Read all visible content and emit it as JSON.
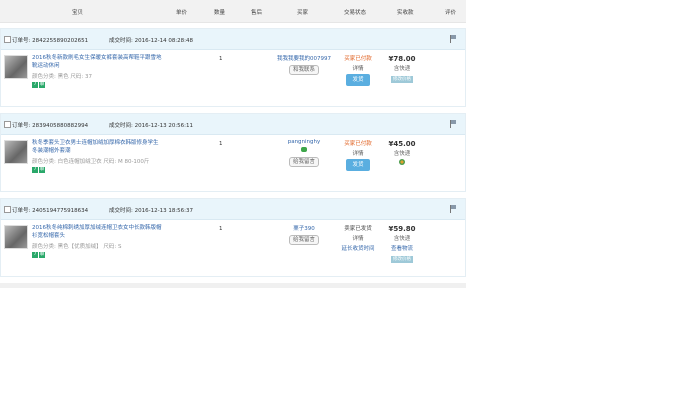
{
  "header": {
    "product": "宝贝",
    "unit_price": "单价",
    "quantity": "数量",
    "after_sale": "售后",
    "buyer": "买家",
    "trade_status": "交易状态",
    "paid": "实收款",
    "rating": "评价"
  },
  "orders": [
    {
      "order_no": "订单号: 2842255890202651",
      "deal_time": "成交时间: 2016-12-14 08:28:48",
      "title": "2016秋冬新款刷毛女生保暖女裤套装高帮鞋平跟雪地靴运动休闲",
      "sku": "颜色分类: 黑色  尺码: 37",
      "qty": "1",
      "buyer": "我我我要我的007997",
      "buyer_badge": "和我联系",
      "status": "买家已付款",
      "detail": "详情",
      "action": "发货",
      "price": "¥78.00",
      "shipping": "含快递",
      "price_tag": "修改价格"
    },
    {
      "order_no": "订单号: 2839405880882994",
      "deal_time": "成交时间: 2016-12-13 20:56:11",
      "title": "秋冬季套头卫衣男士连帽加绒加厚棉衣韩版修身学生冬装潮帽外套潮",
      "sku": "颜色分类: 白色连帽加绒卫衣  尺码: M 80-100斤",
      "qty": "1",
      "buyer": "pangninghy",
      "buyer_badge": "给我留言",
      "status": "买家已付款",
      "detail": "详情",
      "action": "发货",
      "price": "¥45.00",
      "shipping": "含快递",
      "price_tag": ""
    },
    {
      "order_no": "订单号: 2405194775918634",
      "deal_time": "成交时间: 2016-12-13 18:56:37",
      "title": "2016秋冬纯棉刺绣加厚加绒连帽卫衣女中长款韩版帽衫宽松帽套头",
      "sku": "颜色分类: 黑色【优质加绒】  尺码: S",
      "qty": "1",
      "buyer": "栗子390",
      "buyer_badge": "给我留言",
      "status": "卖家已发货",
      "detail": "详情",
      "action": "延长收货时间",
      "price": "¥59.80",
      "shipping": "含快递",
      "price_tag": "查看物流",
      "price_tag2": "修改价格"
    }
  ],
  "tags": {
    "t1": "7",
    "t2": "聊"
  },
  "colors": {
    "header_bg": "#f2f2f2",
    "order_bg": "#e9f5fb",
    "accent": "#5aaee0",
    "status_red": "#e06020",
    "link": "#3366aa"
  }
}
